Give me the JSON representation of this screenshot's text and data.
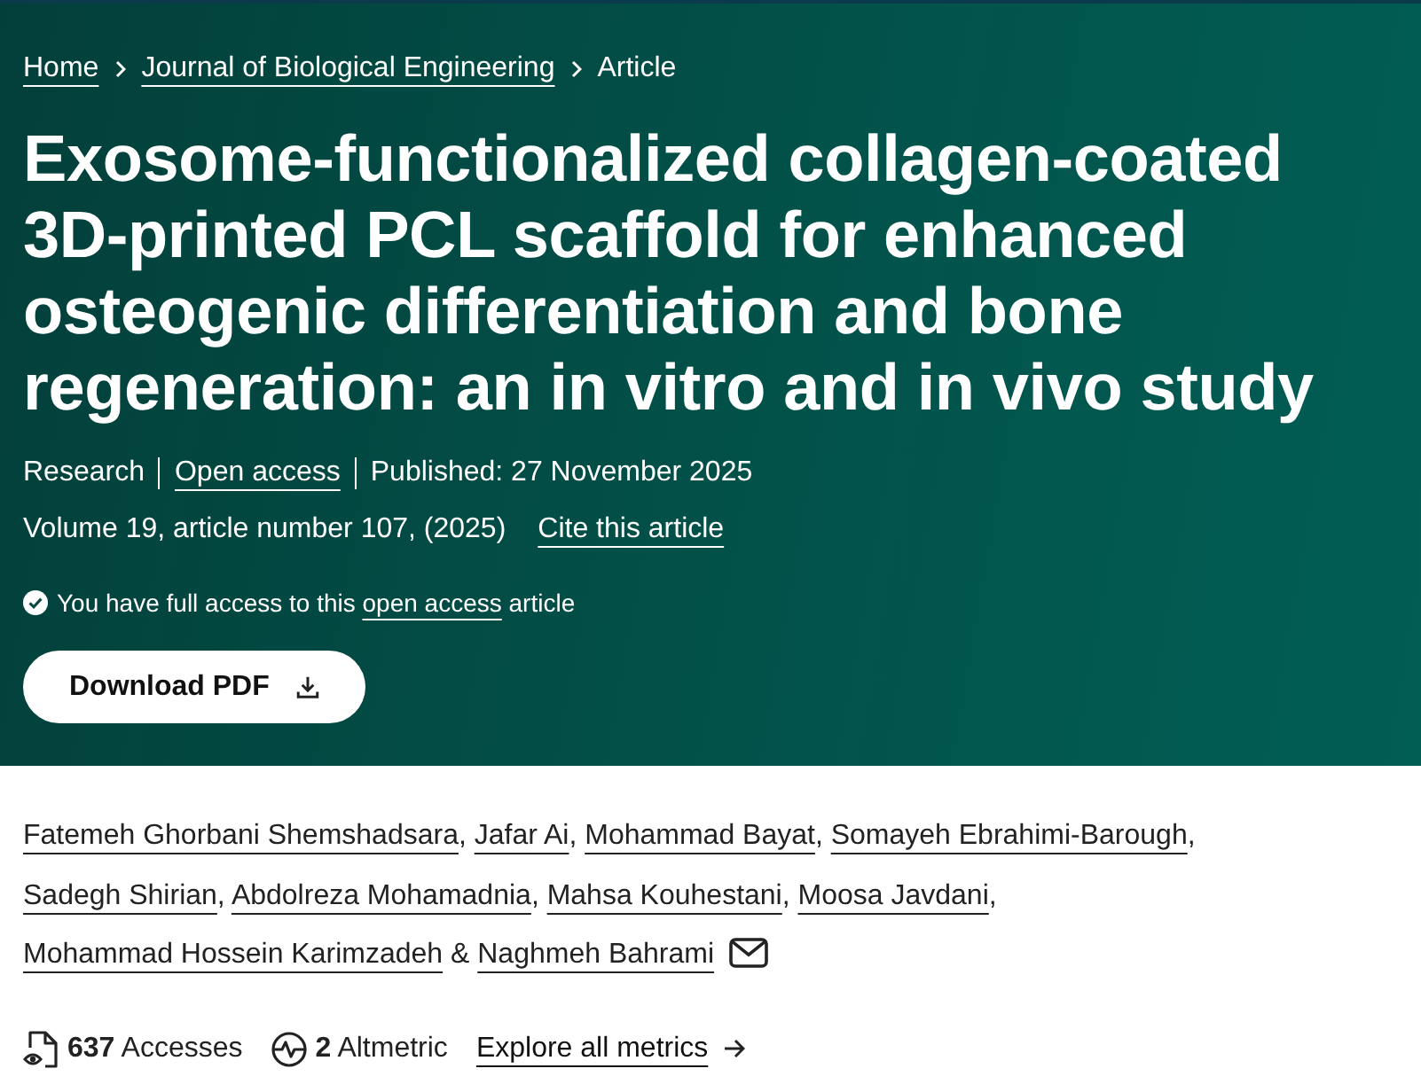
{
  "breadcrumbs": [
    {
      "label": "Home",
      "current": false
    },
    {
      "label": "Journal of Biological Engineering",
      "current": false
    },
    {
      "label": "Article",
      "current": true
    }
  ],
  "title": "Exosome-functionalized collagen-coated 3D-printed PCL scaffold for enhanced osteogenic differentiation and bone regeneration: an in vitro and in vivo study",
  "meta_rows": [
    {
      "divided": true,
      "items": [
        {
          "kind": "text",
          "text": "Research"
        },
        {
          "kind": "link",
          "text": "Open access"
        },
        {
          "kind": "text",
          "text": "Published: 27 November 2025"
        }
      ]
    },
    {
      "divided": false,
      "items": [
        {
          "kind": "text",
          "text": "Volume 19, article number 107, (2025)"
        },
        {
          "kind": "link",
          "text": "Cite this article"
        }
      ]
    }
  ],
  "access_notice": {
    "text": "You have full access to this",
    "link": "open access",
    "after": "article"
  },
  "download_button": {
    "label": "Download PDF"
  },
  "authors": {
    "separator": ",",
    "conjunction": "&",
    "names": [
      {
        "name": "Fatemeh Ghorbani Shemshadsara",
        "email": false
      },
      {
        "name": "Jafar Ai",
        "email": false
      },
      {
        "name": "Mohammad Bayat",
        "email": false
      },
      {
        "name": "Somayeh Ebrahimi-Barough",
        "email": false
      },
      {
        "name": "Sadegh Shirian",
        "email": false
      },
      {
        "name": "Abdolreza Mohamadnia",
        "email": false
      },
      {
        "name": "Mahsa Kouhestani",
        "email": false
      },
      {
        "name": "Moosa Javdani",
        "email": false
      },
      {
        "name": "Mohammad Hossein Karimzadeh",
        "email": false
      },
      {
        "name": "Naghmeh Bahrami",
        "email": true
      }
    ]
  },
  "metrics": [
    {
      "kind": "accesses",
      "text": "**637** Accesses"
    },
    {
      "kind": "altmetric",
      "text": "**2** Altmetric"
    }
  ],
  "metrics_link": {
    "label": "Explore all metrics"
  }
}
